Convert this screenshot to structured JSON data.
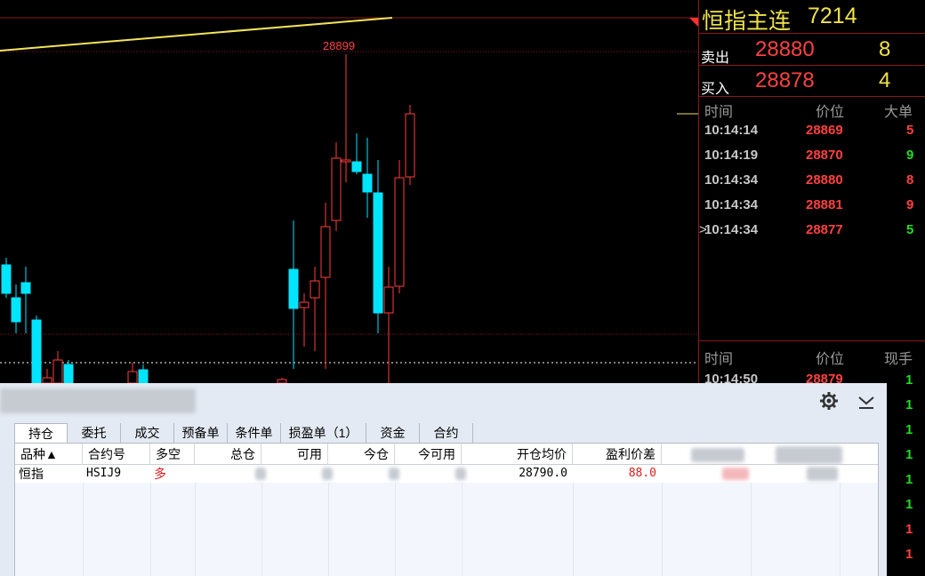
{
  "chart": {
    "high_label": "28899",
    "colors": {
      "up": "#ff3b3b",
      "down": "#00e5ff",
      "ma": "#f4e45a",
      "grid": "#8b1a1a",
      "ref": "#ffffff"
    }
  },
  "quote": {
    "name": "恒指主连",
    "volume": "7214",
    "ask": {
      "label": "卖出",
      "price": "28880",
      "qty": "8"
    },
    "bid": {
      "label": "买入",
      "price": "28878",
      "qty": "4"
    },
    "ticks_header": {
      "time": "时间",
      "price": "价位",
      "qty": "大单"
    },
    "ticks": [
      {
        "time": "10:14:14",
        "price": "28869",
        "qty": "5",
        "color": "#ff4040"
      },
      {
        "time": "10:14:19",
        "price": "28870",
        "qty": "9",
        "color": "#22dd22"
      },
      {
        "time": "10:14:34",
        "price": "28880",
        "qty": "8",
        "color": "#ff4040"
      },
      {
        "time": "10:14:34",
        "price": "28881",
        "qty": "9",
        "color": "#ff4040"
      },
      {
        "time": "10:14:34",
        "price": "28877",
        "qty": "5",
        "color": "#22dd22"
      }
    ],
    "current_marker": ">",
    "ticks2_header": {
      "time": "时间",
      "price": "价位",
      "qty": "现手"
    },
    "ticks2_first": {
      "time": "10:14:50",
      "price": "28879"
    },
    "right_qtys": [
      {
        "q": "1",
        "color": "#22dd22"
      },
      {
        "q": "1",
        "color": "#22dd22"
      },
      {
        "q": "1",
        "color": "#22dd22"
      },
      {
        "q": "1",
        "color": "#22dd22"
      },
      {
        "q": "1",
        "color": "#22dd22"
      },
      {
        "q": "1",
        "color": "#22dd22"
      },
      {
        "q": "1",
        "color": "#ff4040"
      },
      {
        "q": "1",
        "color": "#ff4040"
      }
    ]
  },
  "trade": {
    "tabs": [
      "持仓",
      "委托",
      "成交",
      "预备单",
      "条件单",
      "损盈单（1）",
      "资金",
      "合约"
    ],
    "active_tab": 0,
    "columns": [
      "品种▲",
      "合约号",
      "多空",
      "总仓",
      "可用",
      "今仓",
      "今可用",
      "开仓均价",
      "盈利价差"
    ],
    "row": {
      "product": "恒指",
      "contract": "HSIJ9",
      "side": "多",
      "open_avg": "28790.0",
      "profit_diff": "88.0"
    }
  }
}
